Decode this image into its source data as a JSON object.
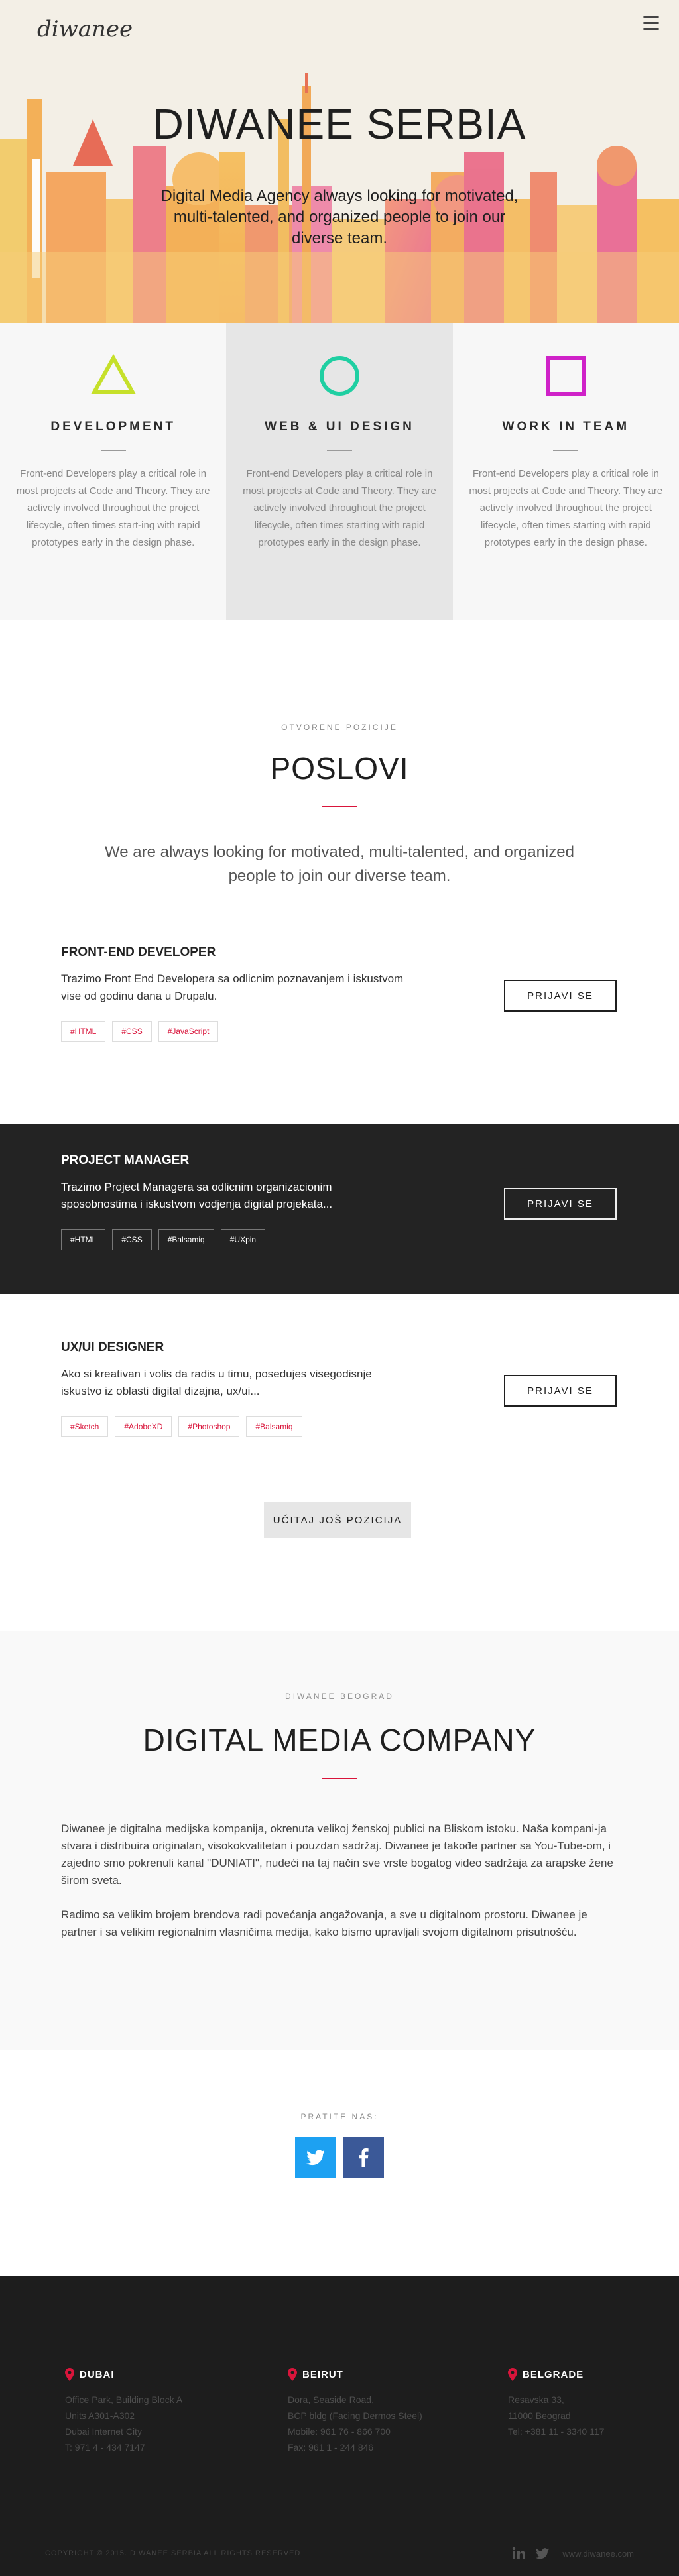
{
  "brand": {
    "logo_text": "diwanee",
    "accent": "#d9153b"
  },
  "hero": {
    "title": "DIWANEE SERBIA",
    "subtitle": "Digital Media Agency always looking for motivated, multi-talented, and organized people to join our diverse team."
  },
  "features": [
    {
      "title": "DEVELOPMENT",
      "text": "Front-end Developers play a critical role in most projects at Code and Theory. They are actively involved throughout the project lifecycle, often times start-ing with rapid prototypes early in the design phase.",
      "icon": "triangle-icon",
      "color": "#c6e02a"
    },
    {
      "title": "WEB & UI DESIGN",
      "text": "Front-end Developers play a critical role in most projects at Code and Theory. They are actively involved throughout the project lifecycle, often times starting with rapid prototypes early in the design phase.",
      "icon": "circle-icon",
      "color": "#1fcfa2"
    },
    {
      "title": "WORK IN TEAM",
      "text": "Front-end Developers play a critical role in most projects at Code and Theory. They are actively involved throughout the project lifecycle, often times starting with rapid prototypes early in the design phase.",
      "icon": "square-icon",
      "color": "#cf22c8"
    }
  ],
  "jobs_section": {
    "eyebrow": "OTVORENE POZICIJE",
    "title": "POSLOVI",
    "lead": "We are always looking for motivated, multi-talented, and organized people to join our diverse team.",
    "apply_label": "PRIJAVI SE",
    "load_more_label": "UČITAJ JOŠ POZICIJA",
    "jobs": [
      {
        "title": "FRONT-END DEVELOPER",
        "text": "Trazimo Front End Developera sa odlicnim poznavanjem i iskustvom vise od godinu dana u Drupalu.",
        "tags": [
          "#HTML",
          "#CSS",
          "#JavaScript"
        ]
      },
      {
        "title": "PROJECT MANAGER",
        "text": "Trazimo Project Managera sa odlicnim organizacionim sposobnostima i iskustvom vodjenja digital projekata...",
        "tags": [
          "#HTML",
          "#CSS",
          "#Balsamiq",
          "#UXpin"
        ]
      },
      {
        "title": "UX/UI DESIGNER",
        "text": "Ako si kreativan i volis da radis u timu, posedujes visegodisnje iskustvo iz oblasti digital dizajna, ux/ui...",
        "tags": [
          "#Sketch",
          "#AdobeXD",
          "#Photoshop",
          "#Balsamiq"
        ]
      }
    ]
  },
  "company": {
    "eyebrow": "DIWANEE BEOGRAD",
    "title": "DIGITAL MEDIA COMPANY",
    "p1": "Diwanee je digitalna medijska kompanija, okrenuta velikoj ženskoj publici na Bliskom istoku. Naša kompani-ja stvara i distribuira originalan, visokokvalitetan i pouzdan sadržaj. Diwanee je takođe partner sa You-Tube-om, i zajedno smo pokrenuli kanal \"DUNIATI\", nudeći na taj način sve vrste bogatog video sadržaja za arapske žene širom sveta.",
    "p2": "Radimo sa velikim brojem brendova radi povećanja angažovanja, a sve u digitalnom prostoru. Diwanee je partner i sa velikim regionalnim vlasničima medija, kako bismo upravljali svojom digitalnom prisutnošću."
  },
  "social": {
    "label": "PRATITE NAS:",
    "twitter": "twitter-icon",
    "facebook": "facebook-icon"
  },
  "footer": {
    "offices": [
      {
        "city": "DUBAI",
        "lines": [
          "Office Park, Building Block A",
          "Units A301-A302",
          "Dubai Internet City",
          "T: 971 4 - 434 7147"
        ]
      },
      {
        "city": "BEIRUT",
        "lines": [
          "Dora, Seaside Road,",
          "BCP bldg (Facing Dermos Steel)",
          "Mobile: 961 76 - 866 700",
          "Fax: 961 1 - 244 846"
        ]
      },
      {
        "city": "BELGRADE",
        "lines": [
          "Resavska 33,",
          "11000 Beograd",
          "Tel: +381 11 - 3340 117"
        ]
      }
    ],
    "copyright": "COPYRIGHT © 2015. DIWANEE SERBIA ALL RIGHTS RESERVED",
    "site": "www.diwanee.com"
  }
}
